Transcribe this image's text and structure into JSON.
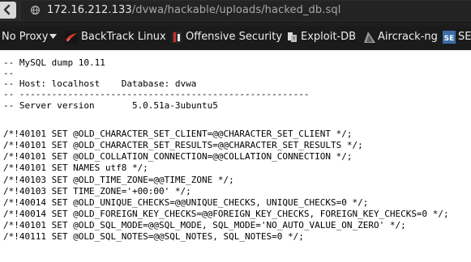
{
  "address_bar": {
    "host": "172.16.212.133",
    "path": "/dvwa/hackable/uploads/hacked_db.sql"
  },
  "bookmarks_toolbar": {
    "items": [
      {
        "label": "No Proxy",
        "icon": "dropdown-arrow-icon"
      },
      {
        "label": "BackTrack Linux",
        "icon": "backtrack-dragon-icon"
      },
      {
        "label": "Offensive Security",
        "icon": "offensive-security-icon"
      },
      {
        "label": "Exploit-DB",
        "icon": "exploit-db-icon"
      },
      {
        "label": "Aircrack-ng",
        "icon": "aircrack-icon"
      },
      {
        "label": "SE",
        "icon": "se-icon"
      }
    ]
  },
  "document": {
    "lines": [
      "-- MySQL dump 10.11",
      "--",
      "-- Host: localhost    Database: dvwa",
      "-- ------------------------------------------------------",
      "-- Server version       5.0.51a-3ubuntu5",
      "",
      "/*!40101 SET @OLD_CHARACTER_SET_CLIENT=@@CHARACTER_SET_CLIENT */;",
      "/*!40101 SET @OLD_CHARACTER_SET_RESULTS=@@CHARACTER_SET_RESULTS */;",
      "/*!40101 SET @OLD_COLLATION_CONNECTION=@@COLLATION_CONNECTION */;",
      "/*!40101 SET NAMES utf8 */;",
      "/*!40103 SET @OLD_TIME_ZONE=@@TIME_ZONE */;",
      "/*!40103 SET TIME_ZONE='+00:00' */;",
      "/*!40014 SET @OLD_UNIQUE_CHECKS=@@UNIQUE_CHECKS, UNIQUE_CHECKS=0 */;",
      "/*!40014 SET @OLD_FOREIGN_KEY_CHECKS=@@FOREIGN_KEY_CHECKS, FOREIGN_KEY_CHECKS=0 */;",
      "/*!40101 SET @OLD_SQL_MODE=@@SQL_MODE, SQL_MODE='NO_AUTO_VALUE_ON_ZERO' */;",
      "/*!40111 SET @OLD_SQL_NOTES=@@SQL_NOTES, SQL_NOTES=0 */;"
    ]
  }
}
